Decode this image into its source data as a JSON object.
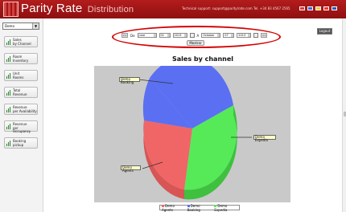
{
  "app": {
    "brand": "Parity Rate",
    "brand_sub": "Distribution",
    "support": "Technical support: support@paritylrate.com Tel. +34 83 4567 2565"
  },
  "header": {
    "flags": [
      "#d33c3c",
      "#3d6bd1",
      "#f3c73a",
      "#e33",
      "#2a58b8"
    ]
  },
  "sidebar": {
    "hotel_select_value": "Demo",
    "items": [
      {
        "label": "Sales\nby Channel"
      },
      {
        "label": "Room\nInventory"
      },
      {
        "label": "Unit\nRooms"
      },
      {
        "label": "Total\nRevenue"
      },
      {
        "label": "Revenue\nper Availability"
      },
      {
        "label": "Revenue\nper Occupancy"
      },
      {
        "label": "Booking\npickup"
      }
    ]
  },
  "filters": {
    "prev_label": "<<",
    "from_label": "De",
    "from_month": "June",
    "from_day": "01",
    "from_year": "2013",
    "to_label": "A",
    "to_month": "October",
    "to_day": "07",
    "to_year": "2013",
    "next_label": ">>",
    "show_button": "Mostrar"
  },
  "logout": "Logout",
  "chart_data": {
    "type": "pie",
    "title": "Sales by channel",
    "series": [
      {
        "name": "Demo Agents",
        "color": "#f06666"
      },
      {
        "name": "Demo Booking",
        "color": "#5a6ff2"
      },
      {
        "name": "Demo Expedia",
        "color": "#56ea59"
      }
    ],
    "slice_labels": [
      "Demo Booking",
      "Demo Expedia",
      "Demo Agents"
    ]
  },
  "legend": {
    "agents": "Demo Agents",
    "booking": "Demo Booking",
    "expedia": "Demo Expedia"
  }
}
